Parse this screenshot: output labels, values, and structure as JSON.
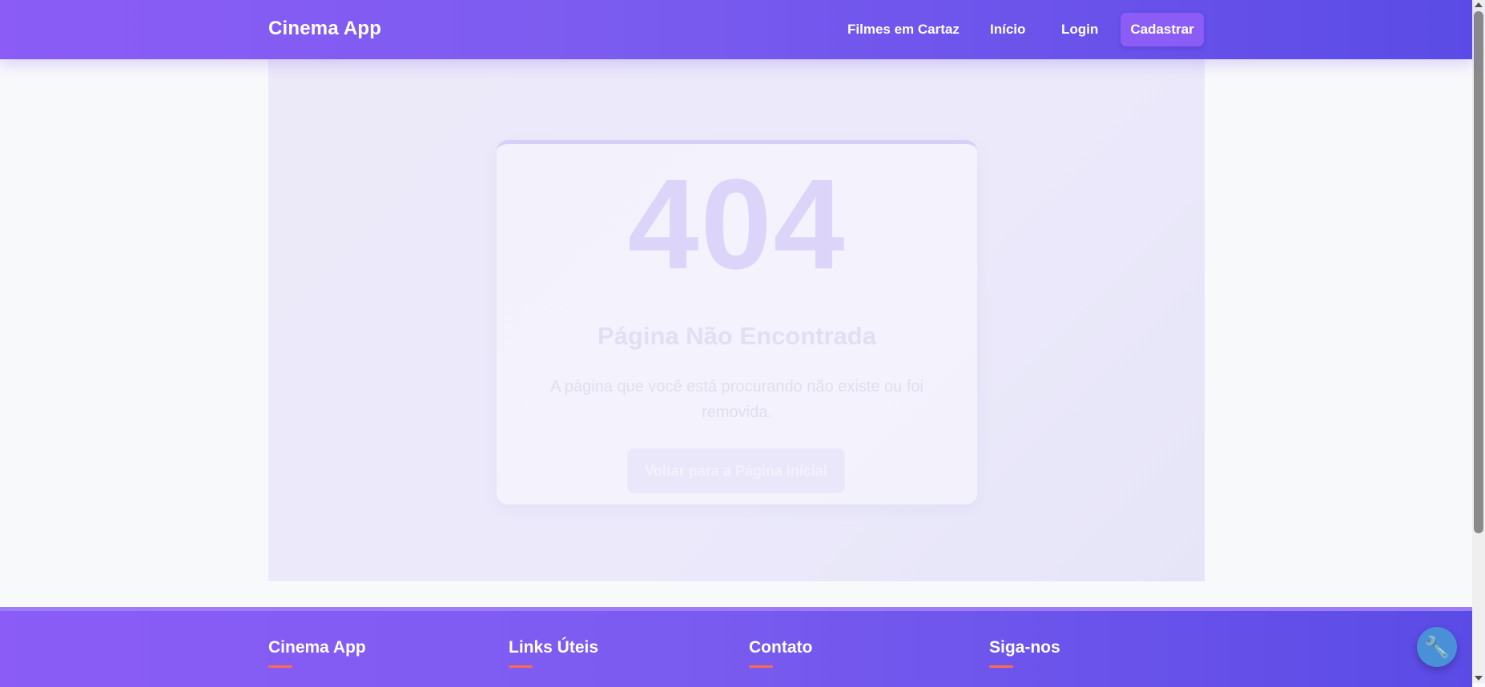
{
  "navbar": {
    "brand": "Cinema App",
    "links": [
      "Filmes em Cartaz",
      "Início",
      "Login"
    ],
    "cta": "Cadastrar"
  },
  "error": {
    "code": "404",
    "title": "Página Não Encontrada",
    "description": "A página que você está procurando não existe ou foi removida.",
    "home_button": "Voltar para a Página Inicial"
  },
  "footer": {
    "columns": [
      "Cinema App",
      "Links Úteis",
      "Contato",
      "Siga-nos"
    ]
  },
  "floating_button": {
    "icon": "wrench-icon"
  },
  "colors": {
    "brand_gradient_start": "#8b5cf6",
    "brand_gradient_end": "#5b4be6",
    "accent_underline": "#ff6b4a",
    "fab": "#4a90d9"
  }
}
